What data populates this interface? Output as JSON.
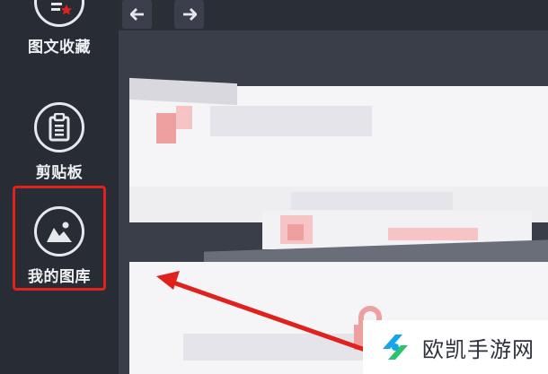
{
  "sidebar": {
    "items": [
      {
        "label": "图文收藏",
        "icon": "doc-star-icon"
      },
      {
        "label": "剪贴板",
        "icon": "clipboard-icon"
      },
      {
        "label": "我的图库",
        "icon": "picture-icon",
        "highlighted": true
      }
    ]
  },
  "topbar": {
    "back_icon": "arrow-left-icon",
    "forward_icon": "arrow-right-icon"
  },
  "annotation": {
    "highlight_color": "#e0211c",
    "arrow_color": "#e0211c"
  },
  "watermark": {
    "text": "欧凯手游网",
    "logo_icon": "watermark-logo-icon"
  },
  "colors": {
    "sidebar_bg": "#282c34",
    "content_bg": "#3a3e49",
    "accent_pink": "#ee9f9f"
  }
}
